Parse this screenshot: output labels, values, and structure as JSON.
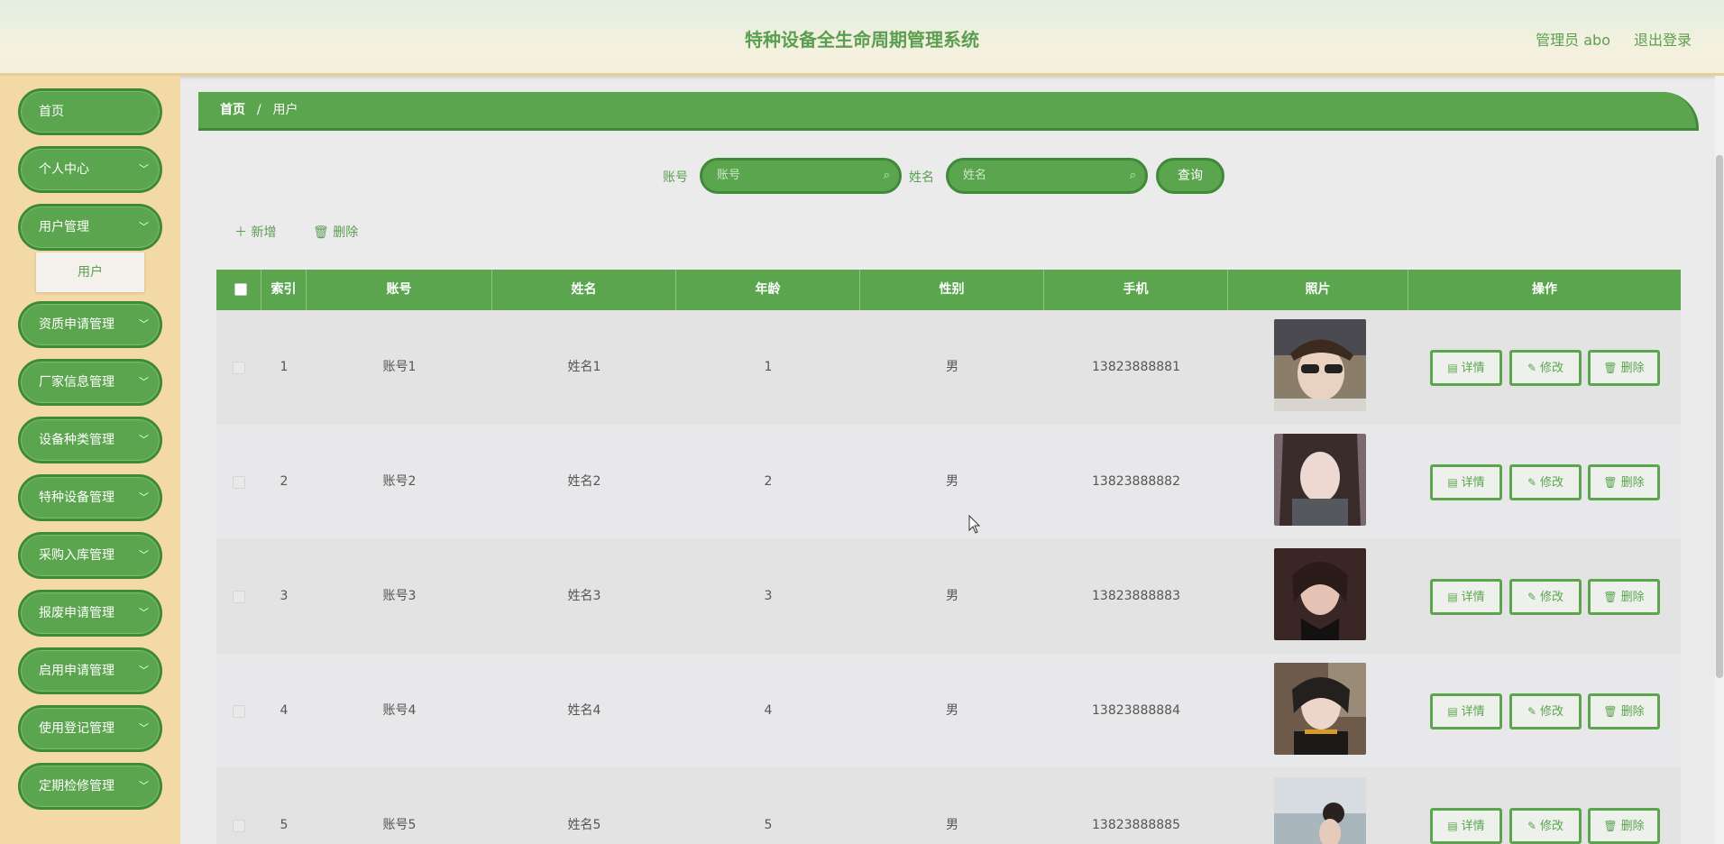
{
  "header": {
    "title": "特种设备全生命周期管理系统",
    "user": "管理员 abo",
    "logout": "退出登录"
  },
  "sidebar": {
    "items": [
      {
        "label": "首页",
        "chevron": false
      },
      {
        "label": "个人中心",
        "chevron": true
      },
      {
        "label": "用户管理",
        "chevron": true
      },
      {
        "label": "资质申请管理",
        "chevron": true
      },
      {
        "label": "厂家信息管理",
        "chevron": true
      },
      {
        "label": "设备种类管理",
        "chevron": true
      },
      {
        "label": "特种设备管理",
        "chevron": true
      },
      {
        "label": "采购入库管理",
        "chevron": true
      },
      {
        "label": "报废申请管理",
        "chevron": true
      },
      {
        "label": "启用申请管理",
        "chevron": true
      },
      {
        "label": "使用登记管理",
        "chevron": true
      },
      {
        "label": "定期检修管理",
        "chevron": true
      }
    ],
    "submenu": "用户"
  },
  "breadcrumb": {
    "home": "首页",
    "sep": "/",
    "current": "用户"
  },
  "search": {
    "account_label": "账号",
    "account_placeholder": "账号",
    "name_label": "姓名",
    "name_placeholder": "姓名",
    "query": "查询"
  },
  "toolbar": {
    "add": "新增",
    "delete": "删除"
  },
  "table": {
    "headers": [
      "索引",
      "账号",
      "姓名",
      "年龄",
      "性别",
      "手机",
      "照片",
      "操作"
    ],
    "rows": [
      {
        "index": "1",
        "account": "账号1",
        "name": "姓名1",
        "age": "1",
        "gender": "男",
        "phone": "13823888881"
      },
      {
        "index": "2",
        "account": "账号2",
        "name": "姓名2",
        "age": "2",
        "gender": "男",
        "phone": "13823888882"
      },
      {
        "index": "3",
        "account": "账号3",
        "name": "姓名3",
        "age": "3",
        "gender": "男",
        "phone": "13823888883"
      },
      {
        "index": "4",
        "account": "账号4",
        "name": "姓名4",
        "age": "4",
        "gender": "男",
        "phone": "13823888884"
      },
      {
        "index": "5",
        "account": "账号5",
        "name": "姓名5",
        "age": "5",
        "gender": "男",
        "phone": "13823888885"
      }
    ],
    "actions": {
      "detail": "详情",
      "edit": "修改",
      "delete": "删除"
    }
  },
  "colors": {
    "primary": "#5aa54e",
    "primary_dark": "#3f8a37",
    "sidebar_bg": "#f2d9a6"
  }
}
